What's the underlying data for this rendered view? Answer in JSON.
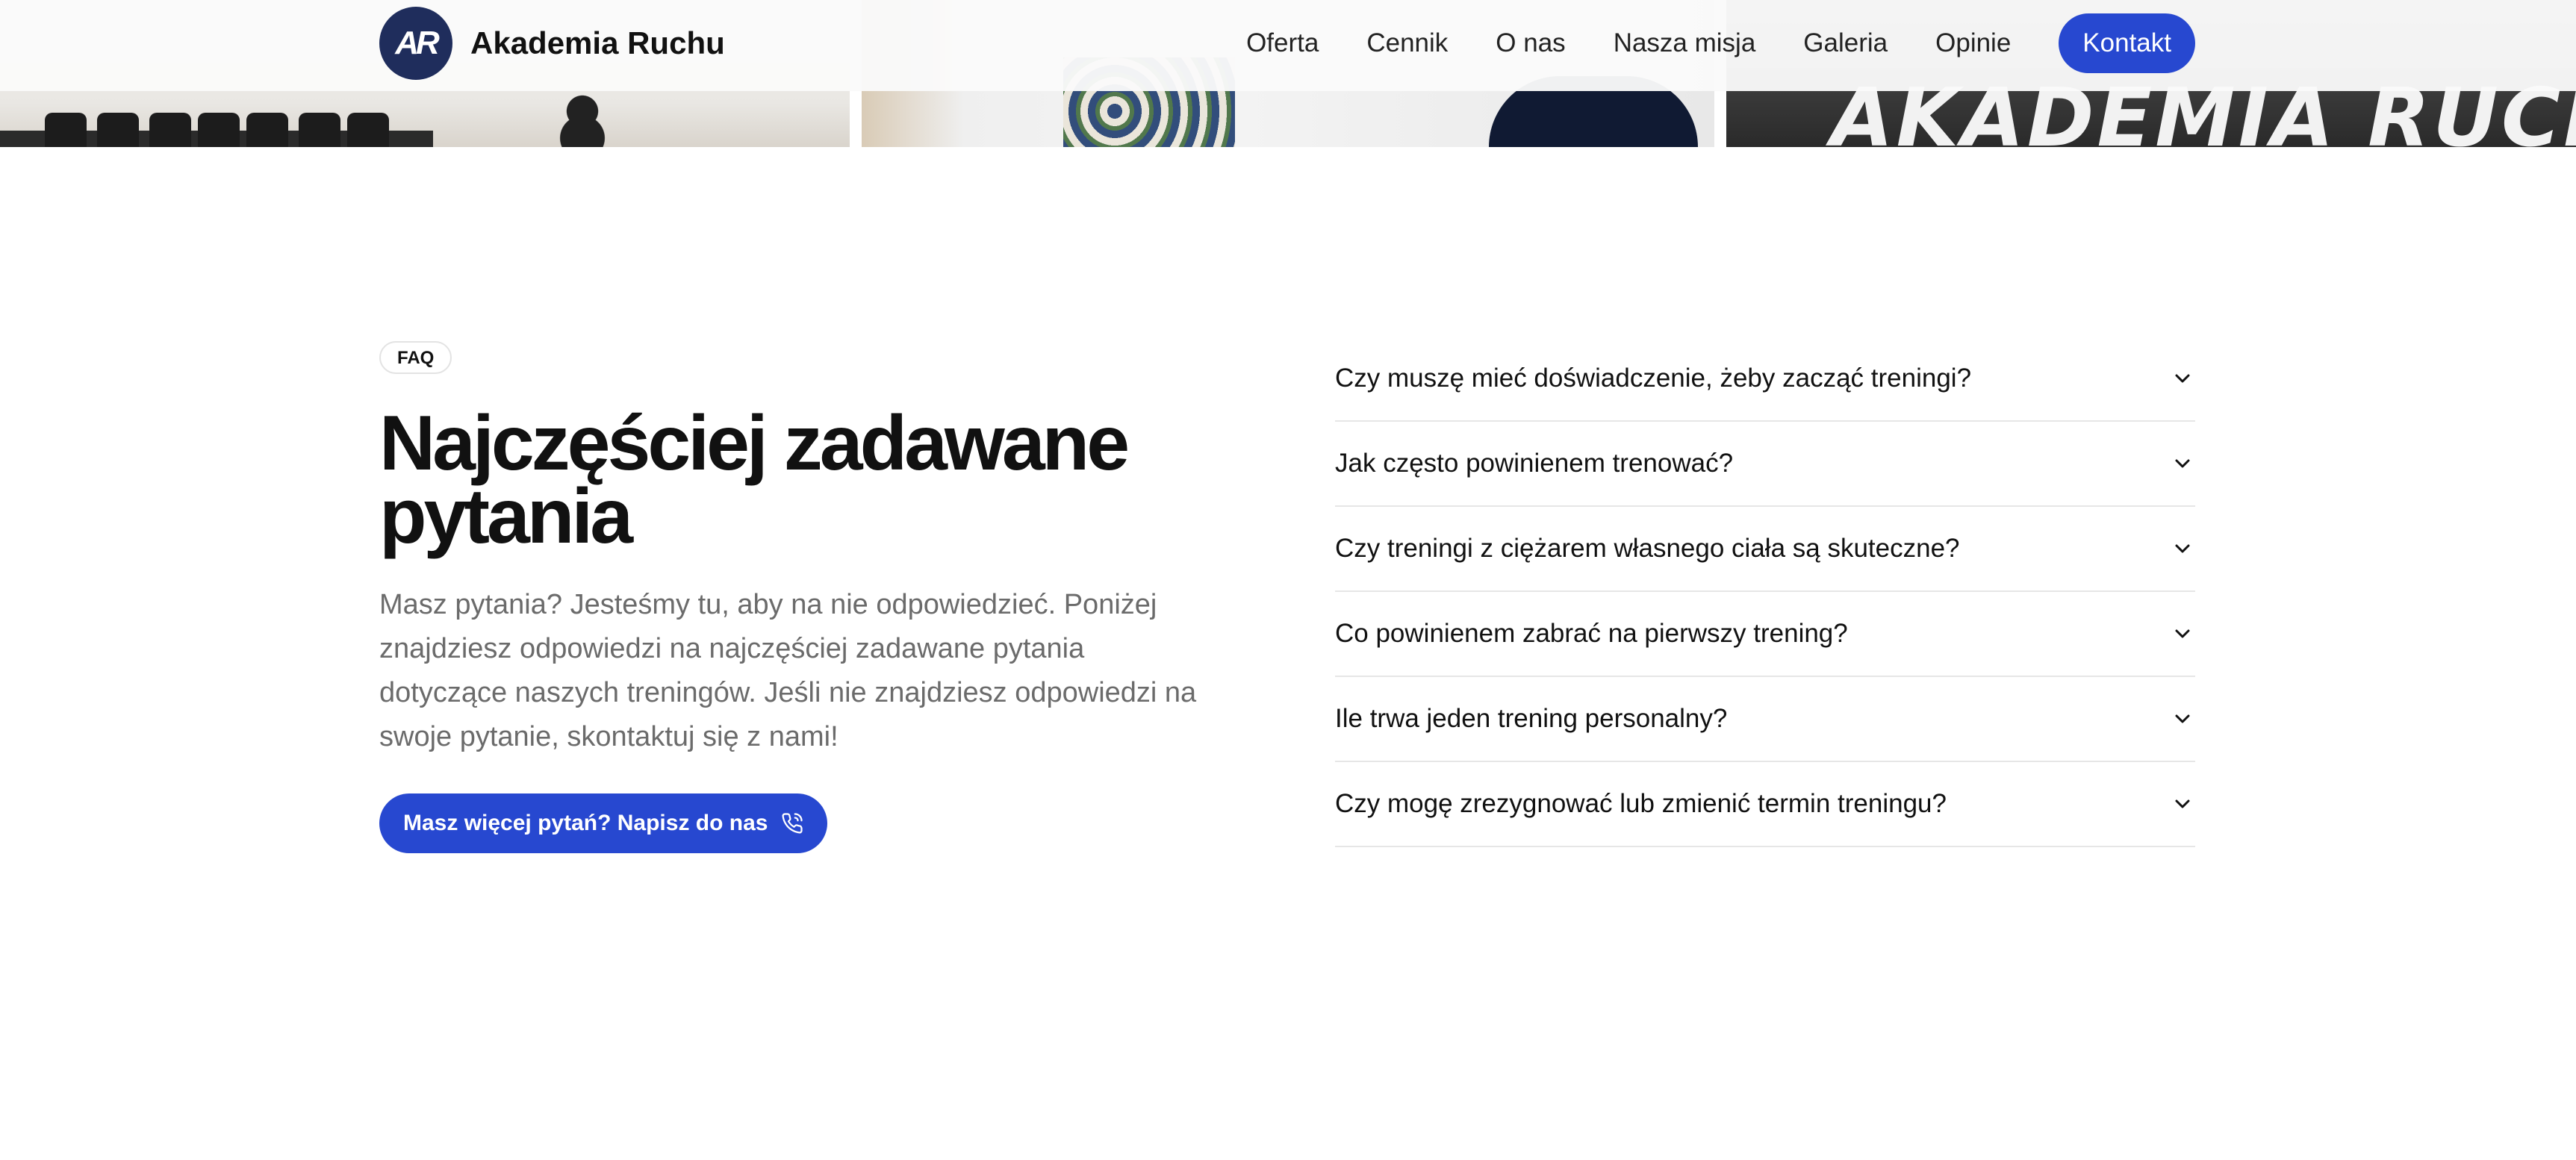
{
  "gallery": {
    "wall_text": "AKADEMIA RUCHU"
  },
  "header": {
    "logo_mark": "AR",
    "brand_name": "Akademia Ruchu",
    "nav": [
      "Oferta",
      "Cennik",
      "O nas",
      "Nasza misja",
      "Galeria",
      "Opinie"
    ],
    "cta_label": "Kontakt"
  },
  "faq": {
    "badge": "FAQ",
    "title": "Najczęściej zadawane pytania",
    "description": "Masz pytania? Jesteśmy tu, aby na nie odpowiedzieć. Poniżej znajdziesz odpowiedzi na najczęściej zadawane pytania dotyczące naszych treningów. Jeśli nie znajdziesz odpowiedzi na swoje pytanie, skontaktuj się z nami!",
    "cta_label": "Masz więcej pytań? Napisz do nas",
    "questions": [
      "Czy muszę mieć doświadczenie, żeby zacząć treningi?",
      "Jak często powinienem trenować?",
      "Czy treningi z ciężarem własnego ciała są skuteczne?",
      "Co powinienem zabrać na pierwszy trening?",
      "Ile trwa jeden trening personalny?",
      "Czy mogę zrezygnować lub zmienić termin treningu?"
    ]
  },
  "colors": {
    "accent": "#2748d0",
    "logo_bg": "#1f2d5c",
    "muted_text": "#6b6b6b"
  },
  "icons": {
    "cta_icon": "phone-icon",
    "accordion_icon": "chevron-down-icon"
  }
}
